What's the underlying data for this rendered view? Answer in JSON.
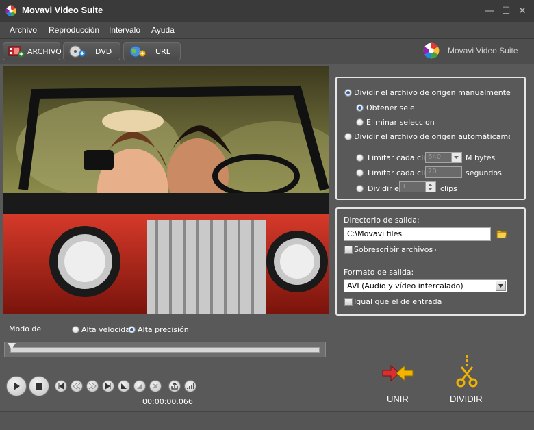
{
  "window": {
    "title": "Movavi Video Suite",
    "min": "—",
    "max": "☐",
    "close": "✕"
  },
  "menu": [
    "Archivo",
    "Reproducción",
    "Intervalo",
    "Ayuda"
  ],
  "toolbar": {
    "archivo": "ARCHIVO",
    "dvd": "DVD",
    "url": "URL"
  },
  "brand": {
    "text": "Movavi Video Suite"
  },
  "split": {
    "manual": "Dividir el archivo de origen manualmente",
    "obtener": "Obtener selecc",
    "eliminar": "Eliminar seleccion",
    "auto": "Dividir el archivo de origen automáticame",
    "limit_size": "Limitar cada clip a",
    "limit_size_value": "640",
    "limit_size_unit": "M bytes",
    "limit_time": "Limitar cada clip a",
    "limit_time_value": "20",
    "limit_time_unit": "segundos",
    "divide_in": "Dividir en",
    "divide_value": "1",
    "divide_unit": "clips"
  },
  "output": {
    "dir_label": "Directorio de salida:",
    "dir_value": "C:\\Movavi files",
    "overwrite": "Sobrescribir archivos exis",
    "format_label": "Formato de salida:",
    "format_value": "AVI (Audio y vídeo intercalado)",
    "same_as_input": "Igual que el de entrada"
  },
  "mode": {
    "label": "Modo de",
    "fast": "Alta velocida",
    "precise": "Alta precisión"
  },
  "player": {
    "timecode": "00:00:00.066",
    "position_fraction": 0.0
  },
  "actions": {
    "join": "UNIR",
    "split": "DIVIDIR"
  },
  "colors": {
    "background": "#595959",
    "titlebar": "#3a3a3a",
    "accent_red": "#d83030",
    "accent_yellow": "#f2b400"
  }
}
